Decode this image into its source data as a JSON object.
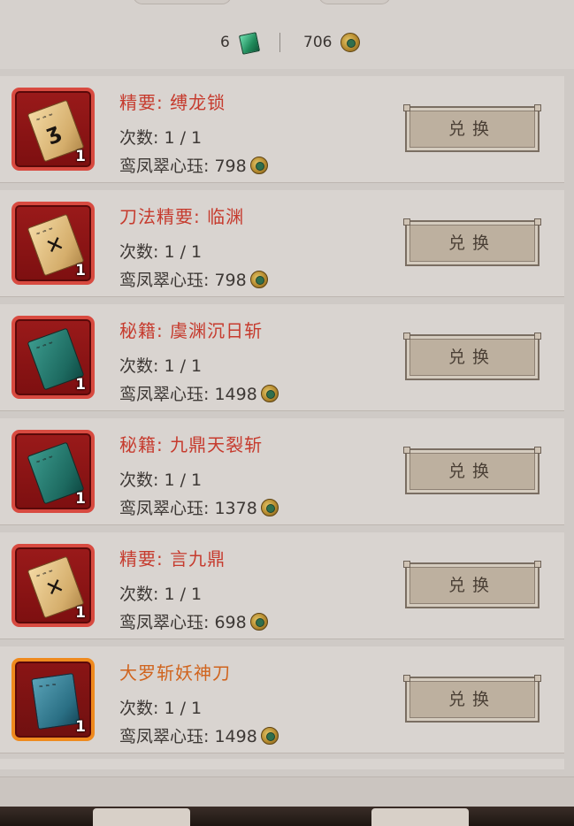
{
  "header": {
    "jade_count": "6",
    "coin_count": "706",
    "jade_icon": "jade-token-icon",
    "coin_icon": "jade-coin-icon"
  },
  "items": [
    {
      "name": "精要: 缚龙锁",
      "count": "次数: 1 / 1",
      "price": "鸾凤翠心珏: 798",
      "qty": "1",
      "button": "兑换",
      "frame": "red",
      "book": "tan",
      "icon": "manual-book-icon"
    },
    {
      "name": "刀法精要: 临渊",
      "count": "次数: 1 / 1",
      "price": "鸾凤翠心珏: 798",
      "qty": "1",
      "button": "兑换",
      "frame": "red",
      "book": "tan",
      "icon": "manual-book-icon"
    },
    {
      "name": "秘籍: 虞渊沉日斩",
      "count": "次数: 1 / 1",
      "price": "鸾凤翠心珏: 1498",
      "qty": "1",
      "button": "兑换",
      "frame": "red",
      "book": "teal",
      "icon": "secret-book-icon"
    },
    {
      "name": "秘籍: 九鼎天裂斩",
      "count": "次数: 1 / 1",
      "price": "鸾凤翠心珏: 1378",
      "qty": "1",
      "button": "兑换",
      "frame": "red",
      "book": "teal",
      "icon": "secret-book-icon"
    },
    {
      "name": "精要: 言九鼎",
      "count": "次数: 1 / 1",
      "price": "鸾凤翠心珏: 698",
      "qty": "1",
      "button": "兑换",
      "frame": "red",
      "book": "tan",
      "icon": "manual-book-icon"
    },
    {
      "name": "大罗斩妖神刀",
      "count": "次数: 1 / 1",
      "price": "鸾凤翠心珏: 1498",
      "qty": "1",
      "button": "兑换",
      "frame": "orange",
      "book": "blue",
      "icon": "blade-book-icon"
    }
  ]
}
